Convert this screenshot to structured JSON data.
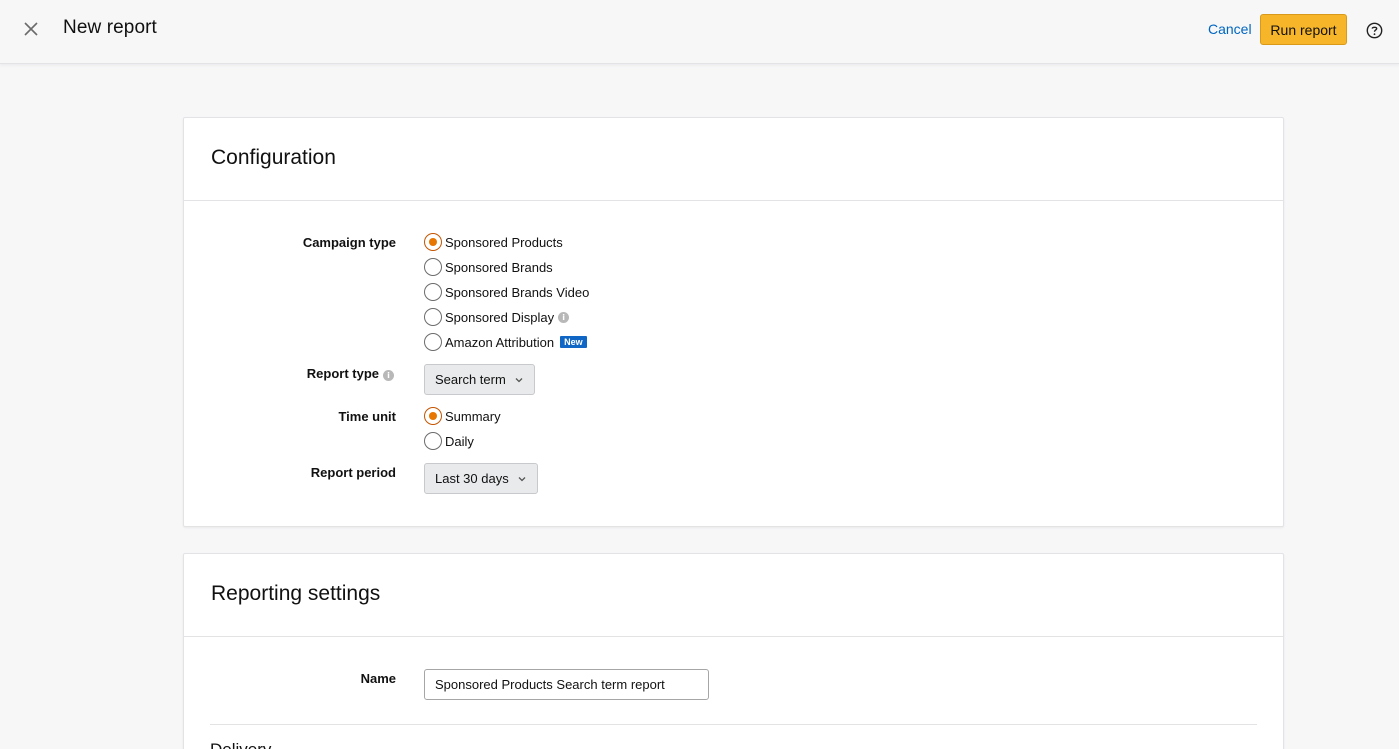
{
  "header": {
    "title": "New report",
    "cancel_label": "Cancel",
    "run_label": "Run report"
  },
  "configuration": {
    "title": "Configuration",
    "campaign_type": {
      "label": "Campaign type",
      "options": [
        {
          "label": "Sponsored Products",
          "checked": true
        },
        {
          "label": "Sponsored Brands",
          "checked": false
        },
        {
          "label": "Sponsored Brands Video",
          "checked": false
        },
        {
          "label": "Sponsored Display",
          "checked": false,
          "info": true
        },
        {
          "label": "Amazon Attribution",
          "checked": false,
          "badge": "New"
        }
      ]
    },
    "report_type": {
      "label": "Report type",
      "value": "Search term"
    },
    "time_unit": {
      "label": "Time unit",
      "options": [
        {
          "label": "Summary",
          "checked": true
        },
        {
          "label": "Daily",
          "checked": false
        }
      ]
    },
    "report_period": {
      "label": "Report period",
      "value": "Last 30 days"
    }
  },
  "reporting_settings": {
    "title": "Reporting settings",
    "name_label": "Name",
    "name_value": "Sponsored Products Search term report",
    "delivery_heading": "Delivery"
  },
  "colors": {
    "accent": "#f7b52a",
    "link": "#0066c0",
    "radio_selected": "#e77600",
    "badge": "#0f66c4"
  }
}
